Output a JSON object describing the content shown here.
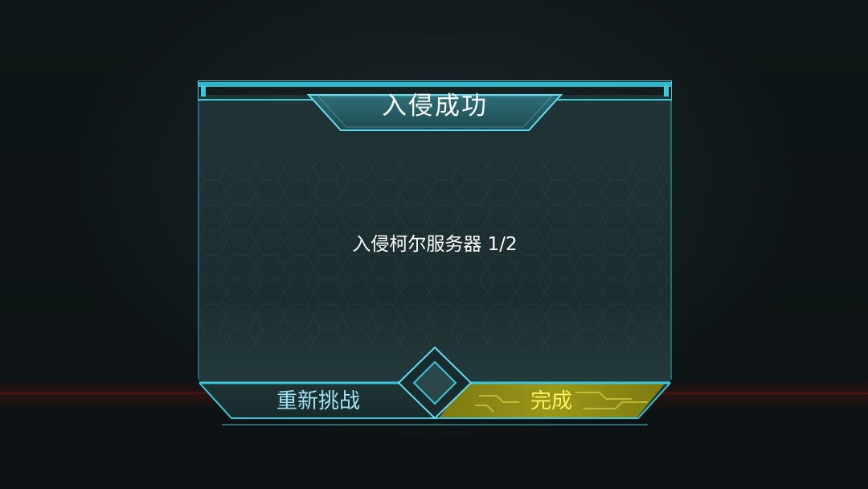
{
  "dialog": {
    "title": "入侵成功",
    "message": "入侵柯尔服务器 1/2"
  },
  "buttons": {
    "retry_label": "重新挑战",
    "done_label": "完成"
  },
  "colors": {
    "frame_cyan": "#39c8dc",
    "panel_fill": "#1e3133",
    "retry_text": "#9fe6f4",
    "done_fill": "#8c8a14",
    "done_text": "#fff25a"
  }
}
